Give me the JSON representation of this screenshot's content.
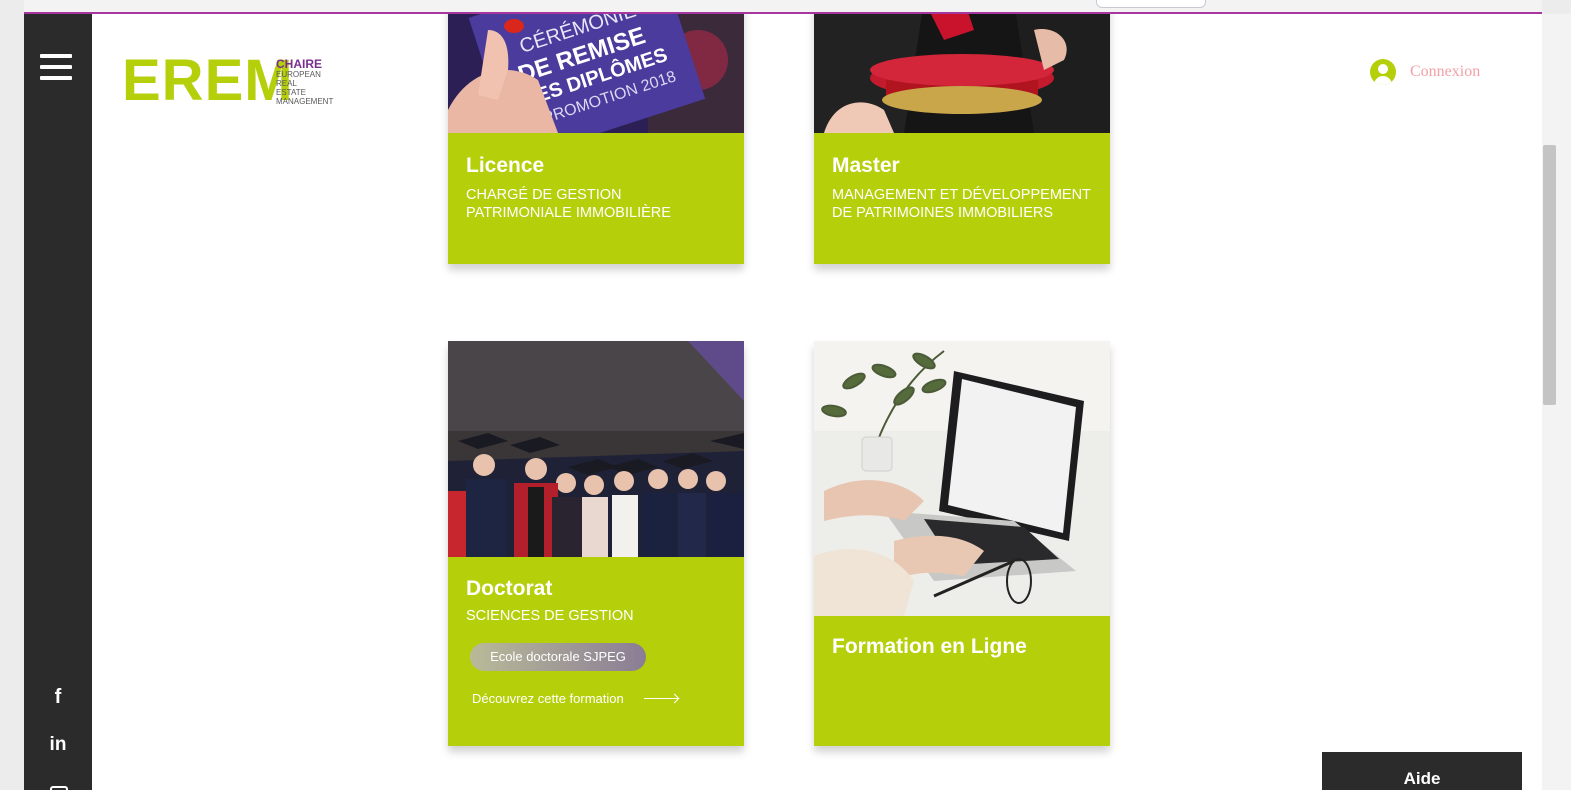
{
  "header": {
    "logo": {
      "main": "EREM",
      "chaire": "CHAIRE",
      "lines": [
        "EUROPEAN",
        "REAL",
        "ESTATE",
        "MANAGEMENT"
      ]
    },
    "connexion_label": "Connexion"
  },
  "sidebar": {
    "social": [
      "f",
      "in"
    ]
  },
  "cards": [
    {
      "title": "Licence",
      "subtitle": "CHARGÉ DE GESTION PATRIMONIALE IMMOBILIÈRE"
    },
    {
      "title": "Master",
      "subtitle": "MANAGEMENT ET DÉVELOPPEMENT DE PATRIMOINES IMMOBILIERS"
    },
    {
      "title": "Doctorat",
      "subtitle": "SCIENCES DE GESTION",
      "badge": "Ecole doctorale SJPEG",
      "link": "Découvrez cette formation"
    },
    {
      "title": "Formation en Ligne"
    }
  ],
  "help_button": "Aide",
  "colors": {
    "accent": "#b5cf0a",
    "sidebar": "#2b2b2b",
    "brand_purple": "#7a2f8f",
    "top_line": "#a6379e"
  }
}
